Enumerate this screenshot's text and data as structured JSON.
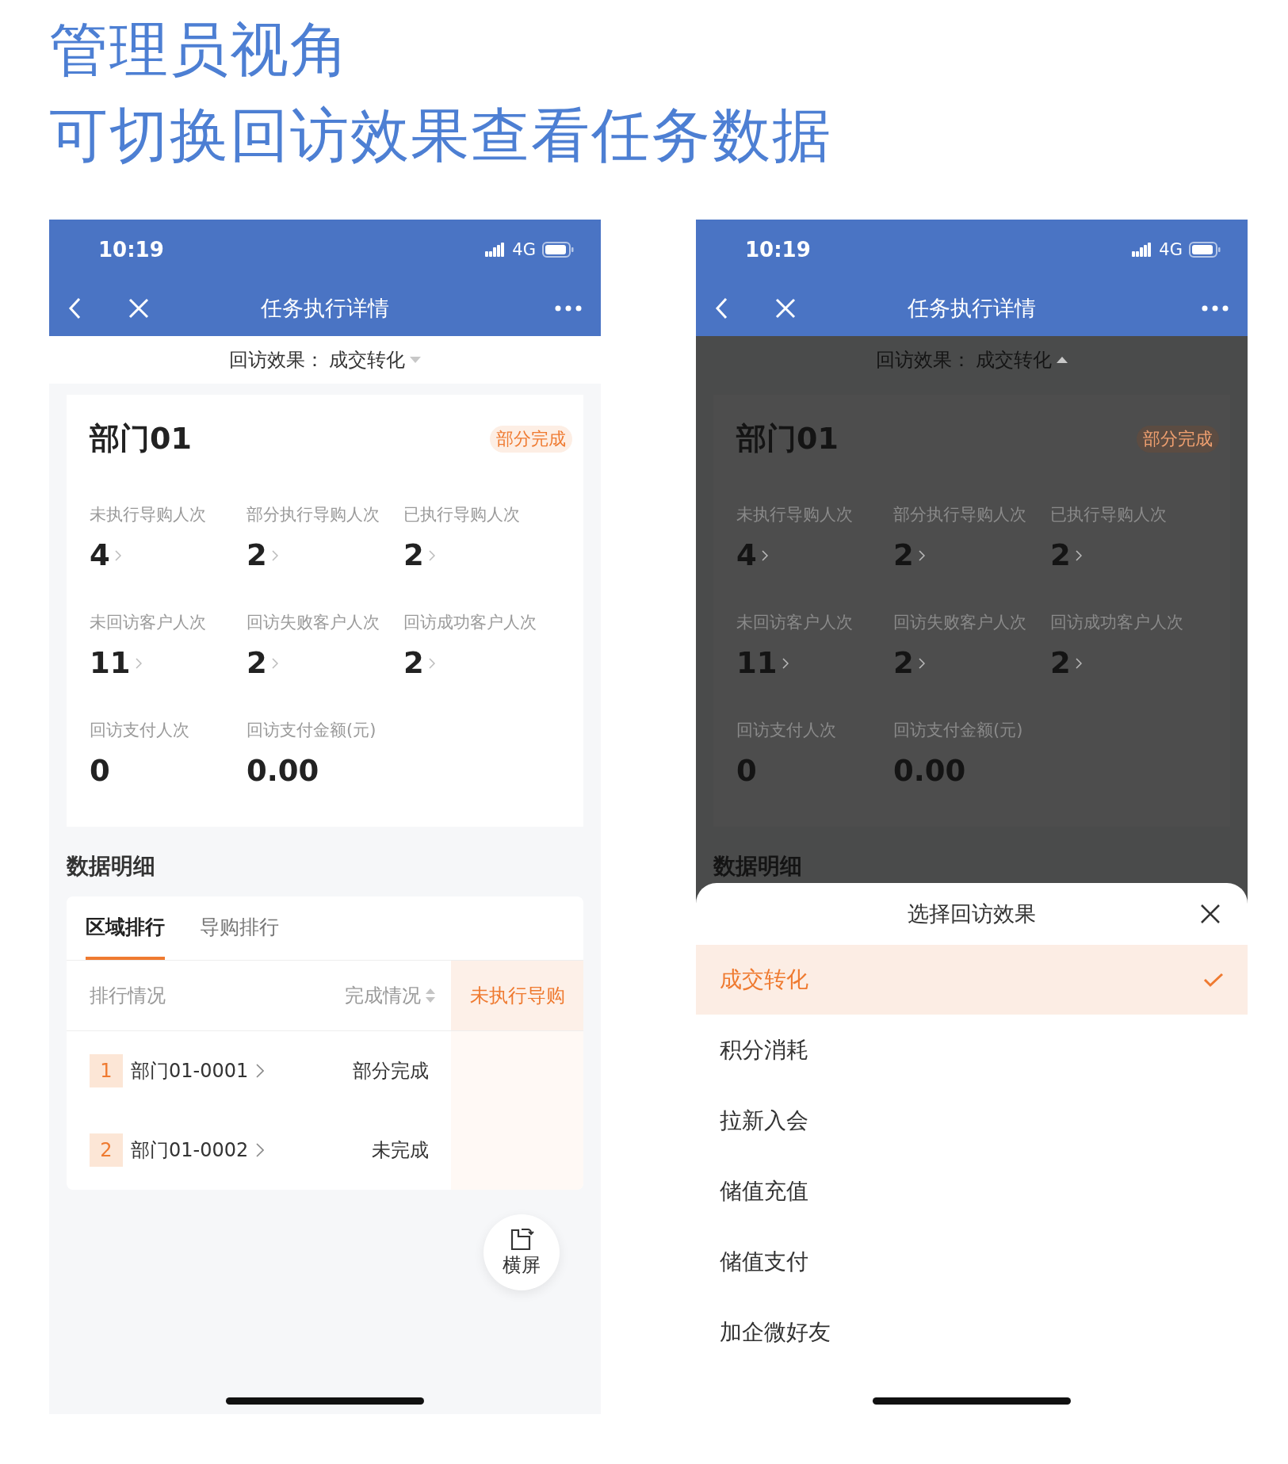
{
  "headline": {
    "lines": [
      "管理员视角",
      "可切换回访效果查看任务数据"
    ]
  },
  "phones": [
    {
      "status_bar": {
        "time": "10:19",
        "network": "4G"
      },
      "nav": {
        "title": "任务执行详情"
      },
      "filter": {
        "label": "回访效果：",
        "value": "成交转化",
        "expanded": false
      },
      "card": {
        "title": "部门01",
        "badge": "部分完成",
        "stats": [
          {
            "label": "未执行导购人次",
            "value": "4",
            "link": true
          },
          {
            "label": "部分执行导购人次",
            "value": "2",
            "link": true
          },
          {
            "label": "已执行导购人次",
            "value": "2",
            "link": true
          },
          {
            "label": "未回访客户人次",
            "value": "11",
            "link": true
          },
          {
            "label": "回访失败客户人次",
            "value": "2",
            "link": true
          },
          {
            "label": "回访成功客户人次",
            "value": "2",
            "link": true
          },
          {
            "label": "回访支付人次",
            "value": "0",
            "link": false
          },
          {
            "label": "回访支付金额(元)",
            "value": "0.00",
            "link": false
          }
        ]
      },
      "section_title": "数据明细",
      "tabs": [
        {
          "label": "区域排行",
          "selected": true
        },
        {
          "label": "导购排行",
          "selected": false
        }
      ],
      "table": {
        "columns": [
          {
            "label": "排行情况",
            "sortable": false,
            "highlighted": false
          },
          {
            "label": "完成情况",
            "sortable": true,
            "highlighted": false
          },
          {
            "label": "未执行导购",
            "sortable": false,
            "highlighted": true
          }
        ],
        "rows": [
          {
            "rank": "1",
            "name": "部门01-0001",
            "status": "部分完成"
          },
          {
            "rank": "2",
            "name": "部门01-0002",
            "status": "未完成"
          }
        ]
      },
      "fab": {
        "label": "横屏"
      }
    },
    {
      "status_bar": {
        "time": "10:19",
        "network": "4G"
      },
      "nav": {
        "title": "任务执行详情"
      },
      "filter": {
        "label": "回访效果：",
        "value": "成交转化",
        "expanded": true
      },
      "card": {
        "title": "部门01",
        "badge": "部分完成",
        "stats": [
          {
            "label": "未执行导购人次",
            "value": "4",
            "link": true
          },
          {
            "label": "部分执行导购人次",
            "value": "2",
            "link": true
          },
          {
            "label": "已执行导购人次",
            "value": "2",
            "link": true
          },
          {
            "label": "未回访客户人次",
            "value": "11",
            "link": true
          },
          {
            "label": "回访失败客户人次",
            "value": "2",
            "link": true
          },
          {
            "label": "回访成功客户人次",
            "value": "2",
            "link": true
          },
          {
            "label": "回访支付人次",
            "value": "0",
            "link": false
          },
          {
            "label": "回访支付金额(元)",
            "value": "0.00",
            "link": false
          }
        ]
      },
      "section_title": "数据明细",
      "sheet": {
        "title": "选择回访效果",
        "options": [
          {
            "label": "成交转化",
            "selected": true
          },
          {
            "label": "积分消耗",
            "selected": false
          },
          {
            "label": "拉新入会",
            "selected": false
          },
          {
            "label": "储值充值",
            "selected": false
          },
          {
            "label": "储值支付",
            "selected": false
          },
          {
            "label": "加企微好友",
            "selected": false
          }
        ]
      }
    }
  ]
}
